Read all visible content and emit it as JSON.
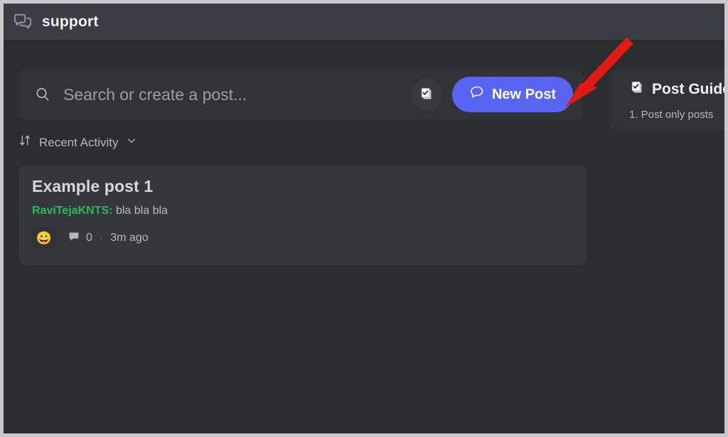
{
  "window": {
    "frame_color": "#c9cacc",
    "background": "#2b2d31"
  },
  "header": {
    "channel_icon": "forum-channel-icon",
    "title": "support"
  },
  "search": {
    "icon": "search-icon",
    "placeholder": "Search or create a post...",
    "value": "",
    "guidelines_button_icon": "clipboard-check-icon",
    "new_post": {
      "icon": "speech-bubble-icon",
      "label": "New Post",
      "color": "#5865f2"
    }
  },
  "guidelines_card": {
    "icon": "clipboard-check-icon",
    "title": "Post Guidelines",
    "lines": [
      "1. Post only posts"
    ]
  },
  "sort": {
    "icon": "sort-arrows-icon",
    "label": "Recent Activity",
    "chevron": "chevron-down-icon"
  },
  "posts": [
    {
      "title": "Example post 1",
      "author": "RaviTejaKNTS:",
      "author_color": "#2cb85e",
      "preview": "bla bla bla",
      "reaction_emoji": "😀",
      "comment_icon": "comment-icon",
      "comment_count": "0",
      "separator": "·",
      "timestamp": "3m ago"
    }
  ],
  "annotation": {
    "arrow_color": "#e01b15",
    "points_to": "New Post"
  }
}
